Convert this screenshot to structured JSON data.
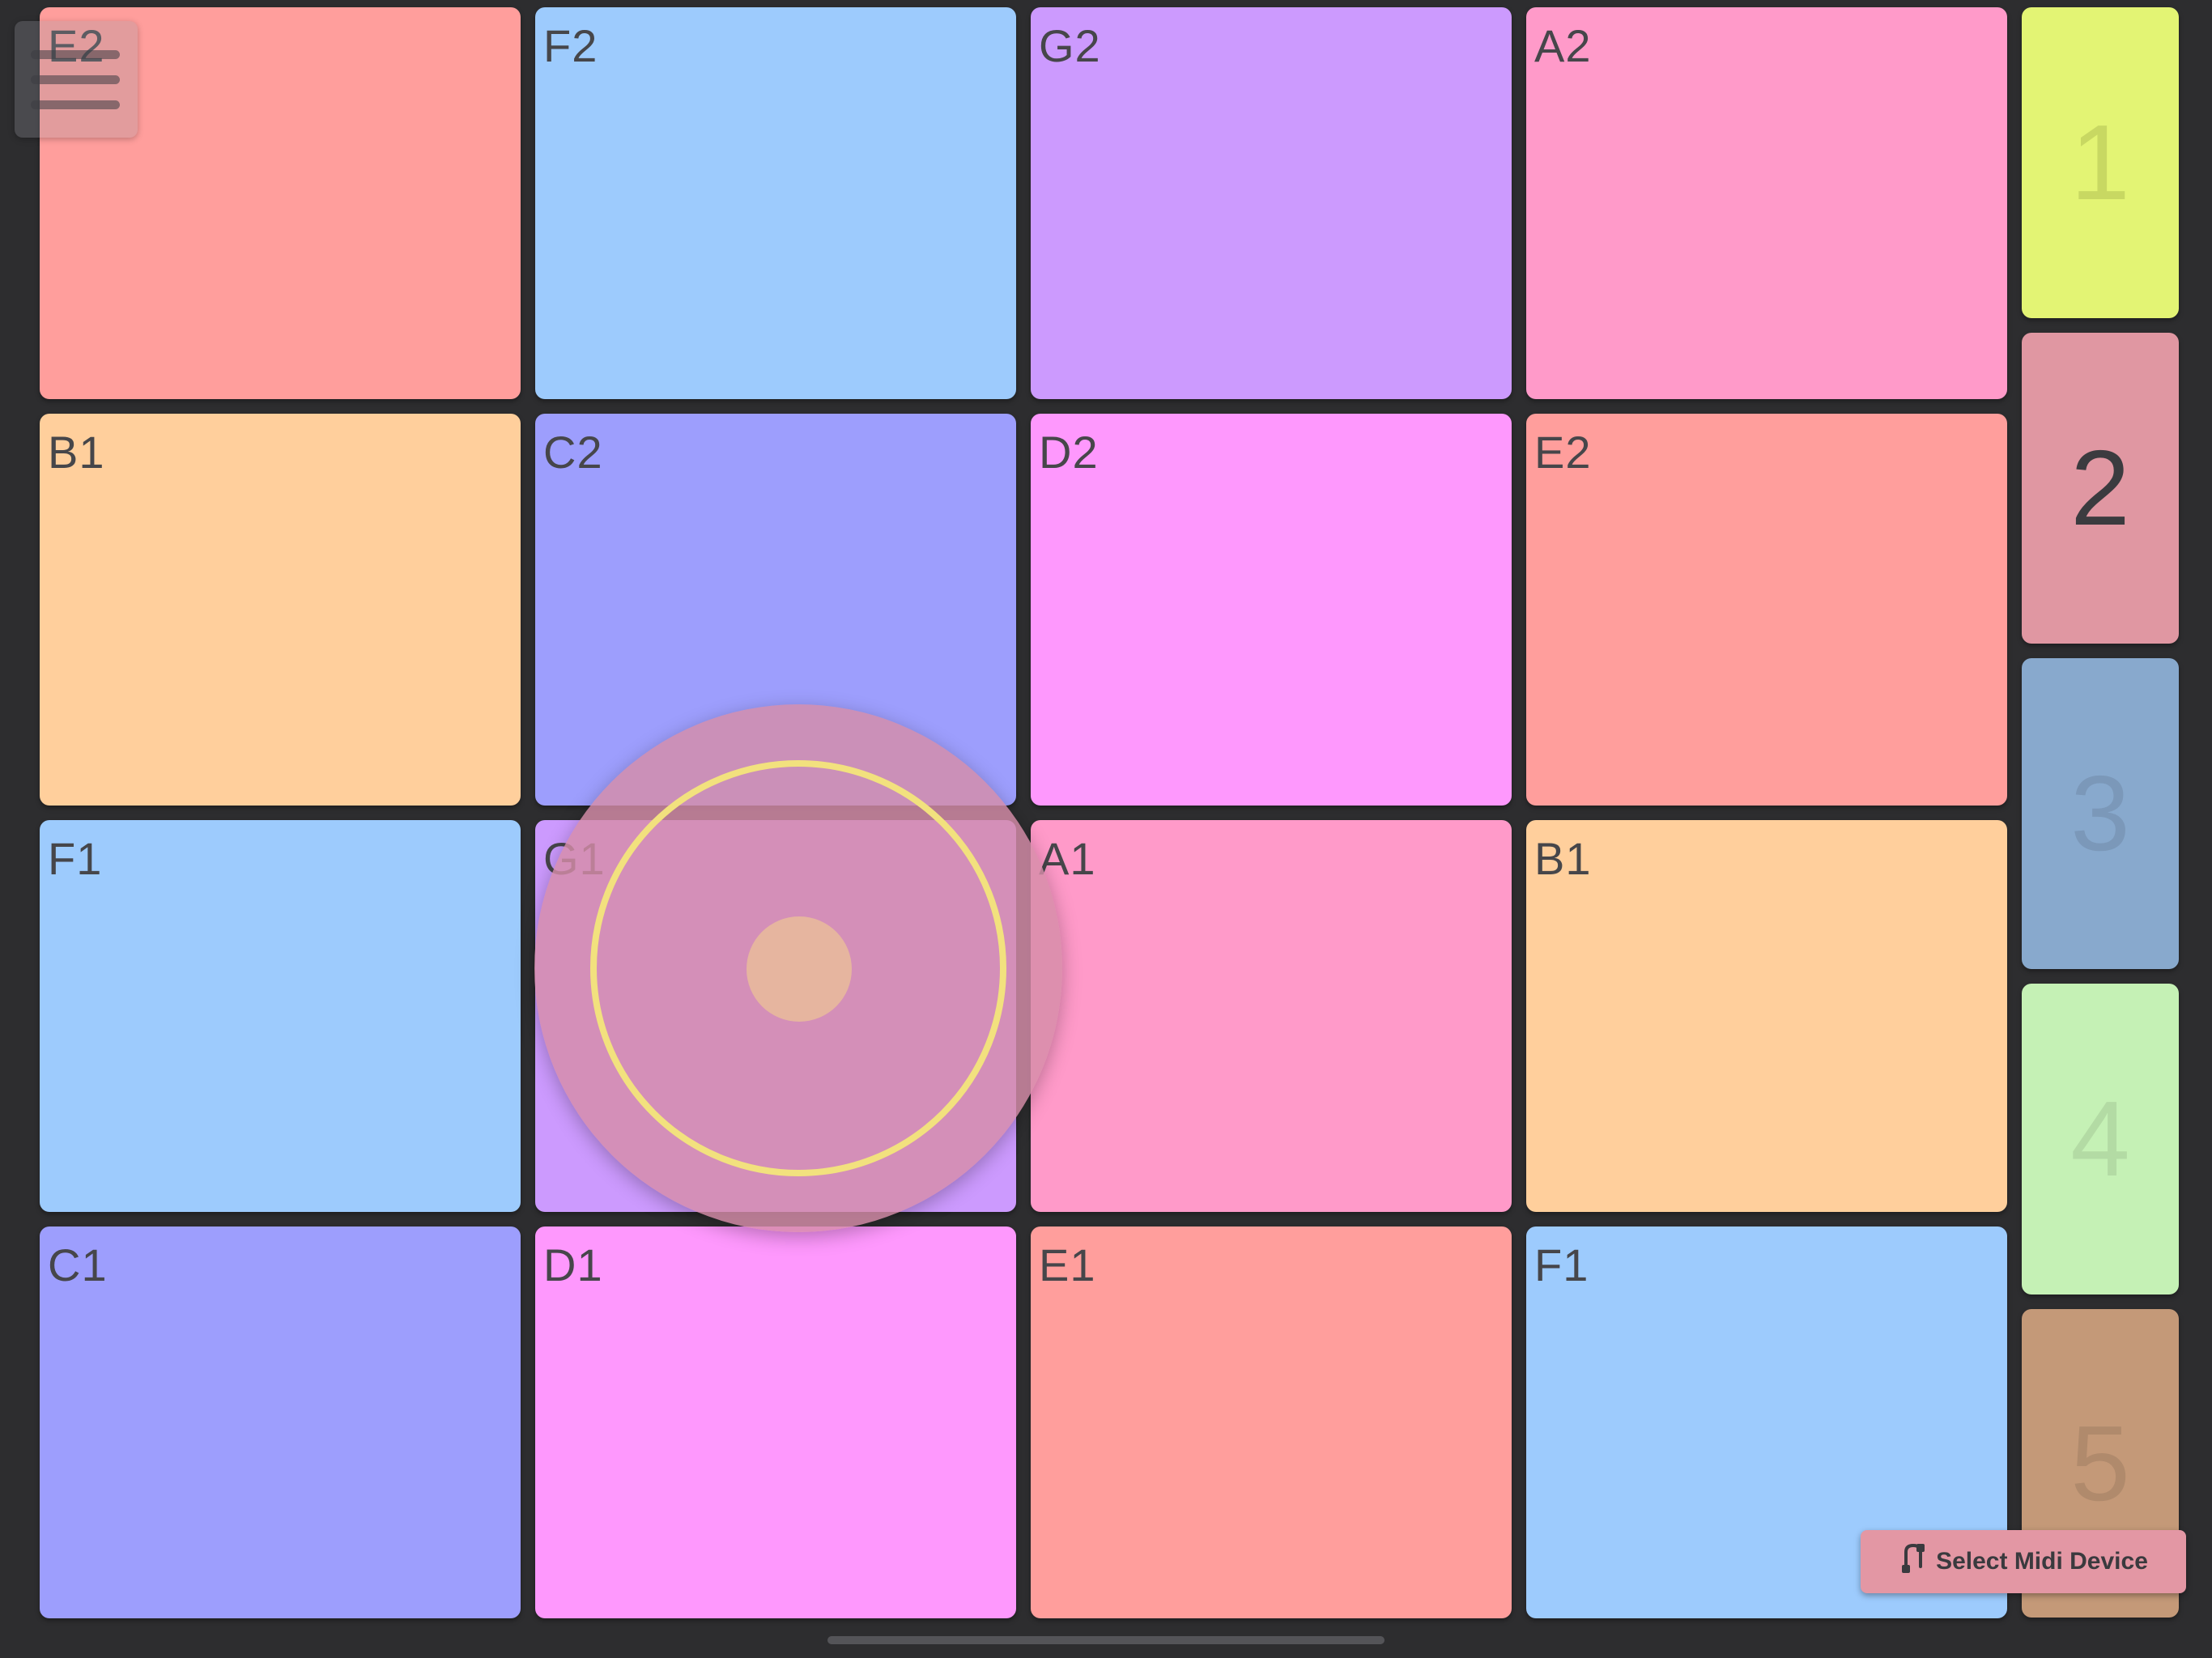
{
  "pads": [
    {
      "label": "E2",
      "color": "#ff9e9c"
    },
    {
      "label": "F2",
      "color": "#9dcbfd"
    },
    {
      "label": "G2",
      "color": "#cc9afe"
    },
    {
      "label": "A2",
      "color": "#ff9ac9"
    },
    {
      "label": "B1",
      "color": "#ffcf9c"
    },
    {
      "label": "C2",
      "color": "#9d9efd"
    },
    {
      "label": "D2",
      "color": "#fe98fd"
    },
    {
      "label": "E2",
      "color": "#ff9e9c"
    },
    {
      "label": "F1",
      "color": "#9dcbfd"
    },
    {
      "label": "G1",
      "color": "#cc9afe"
    },
    {
      "label": "A1",
      "color": "#ff9ac9"
    },
    {
      "label": "B1",
      "color": "#ffcf9c"
    },
    {
      "label": "C1",
      "color": "#9d9efd"
    },
    {
      "label": "D1",
      "color": "#fe98fd"
    },
    {
      "label": "E1",
      "color": "#ff9e9c"
    },
    {
      "label": "F1",
      "color": "#9dcbfd"
    }
  ],
  "banks": [
    {
      "label": "1",
      "color": "#e3f474",
      "text_color": "#c8d862",
      "selected": false
    },
    {
      "label": "2",
      "color": "#e097a2",
      "text_color": "#3b3b3f",
      "selected": true
    },
    {
      "label": "3",
      "color": "#88a9cd",
      "text_color": "#7b98b9",
      "selected": false
    },
    {
      "label": "4",
      "color": "#c5f1b5",
      "text_color": "#b3dba4",
      "selected": false
    },
    {
      "label": "5",
      "color": "#c49978",
      "text_color": "#b08a6c",
      "selected": false
    }
  ],
  "midi_button": {
    "label": "Select Midi Device",
    "icon": "midi-cable-icon"
  },
  "menu_button": {
    "icon": "hamburger-menu-icon"
  },
  "touch_indicator": {
    "ring_color": "#f2e17e",
    "halo_color": "#d68ca8"
  }
}
